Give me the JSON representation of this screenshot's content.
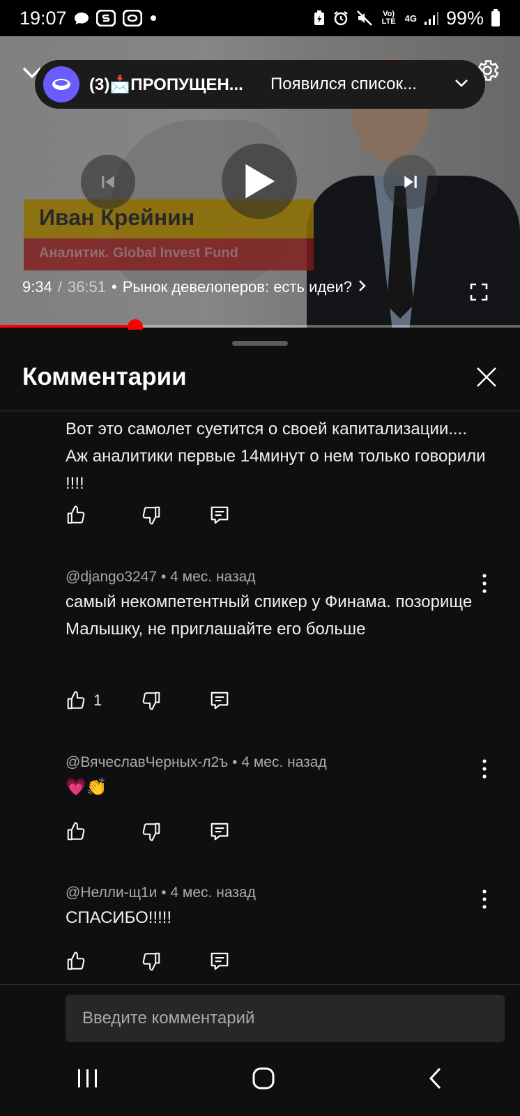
{
  "status_bar": {
    "time": "19:07",
    "battery": "99%",
    "network_volte": "Vo) LTE",
    "network_gen": "4G",
    "icons": [
      "chat-bubble-icon",
      "samsung-icon",
      "app-icon",
      "dot-icon",
      "battery-saver-icon",
      "alarm-icon",
      "mute-icon",
      "volte-icon",
      "signal-icon",
      "battery-icon"
    ]
  },
  "video": {
    "overlay_name": "Иван Крейнин",
    "overlay_role": "Аналитик. Global Invest Fund",
    "current_time": "9:34",
    "duration": "36:51",
    "chapter": "Рынок девелоперов: есть идеи?",
    "progress_fraction": 0.26
  },
  "notification": {
    "title": "(3)📩ПРОПУЩЕН...",
    "text": "Появился список..."
  },
  "comments_sheet": {
    "title": "Комментарии",
    "comments": [
      {
        "author": "",
        "age": "",
        "text": "Вот это самолет суетится о своей капитализации.... Аж аналитики первые 14минут о нем только говорили !!!!",
        "likes": ""
      },
      {
        "author": "@django3247",
        "age": "4 мес. назад",
        "text": "самый некомпетентный спикер у Финама. позорище Малышку, не приглашайте его больше",
        "likes": "1"
      },
      {
        "author": "@ВячеславЧерных-л2ъ",
        "age": "4 мес. назад",
        "text": "💗👏",
        "likes": ""
      },
      {
        "author": "@Нелли-щ1и",
        "age": "4 мес. назад",
        "text": "СПАСИБО!!!!!",
        "likes": ""
      }
    ],
    "input_placeholder": "Введите комментарий"
  },
  "colors": {
    "accent": "#ff0000",
    "background": "#0f0f0f",
    "secondary_text": "#aaaaaa"
  }
}
